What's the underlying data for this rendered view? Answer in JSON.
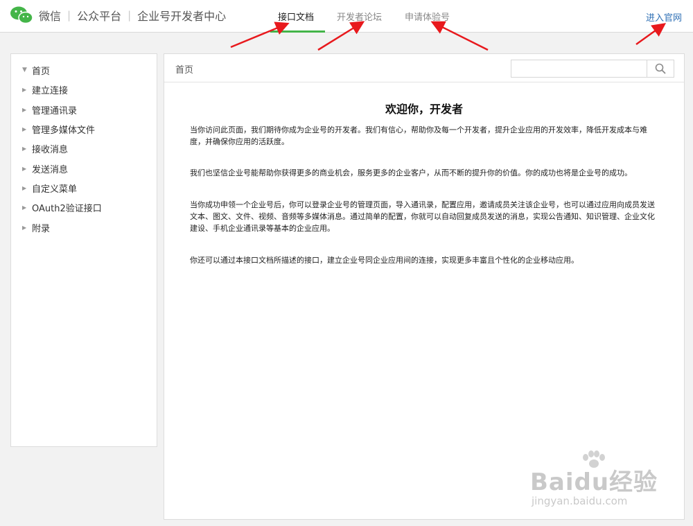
{
  "header": {
    "brand_parts": [
      "微信",
      "公众平台",
      "企业号开发者中心"
    ],
    "tabs": [
      {
        "label": "接口文档",
        "active": true
      },
      {
        "label": "开发者论坛",
        "active": false
      },
      {
        "label": "申请体验号",
        "active": false
      }
    ],
    "official_link": "进入官网"
  },
  "sidebar": {
    "items": [
      {
        "label": "首页",
        "expanded": true
      },
      {
        "label": "建立连接",
        "expanded": false
      },
      {
        "label": "管理通讯录",
        "expanded": false
      },
      {
        "label": "管理多媒体文件",
        "expanded": false
      },
      {
        "label": "接收消息",
        "expanded": false
      },
      {
        "label": "发送消息",
        "expanded": false
      },
      {
        "label": "自定义菜单",
        "expanded": false
      },
      {
        "label": "OAuth2验证接口",
        "expanded": false
      },
      {
        "label": "附录",
        "expanded": false
      }
    ]
  },
  "main": {
    "breadcrumb": "首页",
    "search": {
      "placeholder": "",
      "value": ""
    },
    "title": "欢迎你，开发者",
    "paragraphs": [
      "当你访问此页面，我们期待你成为企业号的开发者。我们有信心，帮助你及每一个开发者，提升企业应用的开发效率，降低开发成本与难度，并确保你应用的活跃度。",
      "我们也坚信企业号能帮助你获得更多的商业机会，服务更多的企业客户，从而不断的提升你的价值。你的成功也将是企业号的成功。",
      "当你成功申领一个企业号后，你可以登录企业号的管理页面，导入通讯录，配置应用，邀请成员关注该企业号，也可以通过应用向成员发送文本、图文、文件、视频、音频等多媒体消息。通过简单的配置，你就可以自动回复成员发送的消息，实现公告通知、知识管理、企业文化建设、手机企业通讯录等基本的企业应用。",
      "你还可以通过本接口文档所描述的接口，建立企业号同企业应用间的连接，实现更多丰富且个性化的企业移动应用。"
    ]
  },
  "watermark": {
    "main": "Baidu经验",
    "sub": "jingyan.baidu.com"
  },
  "colors": {
    "accent": "#44b549",
    "link": "#2e6fb5",
    "arrow": "#e8191d"
  }
}
